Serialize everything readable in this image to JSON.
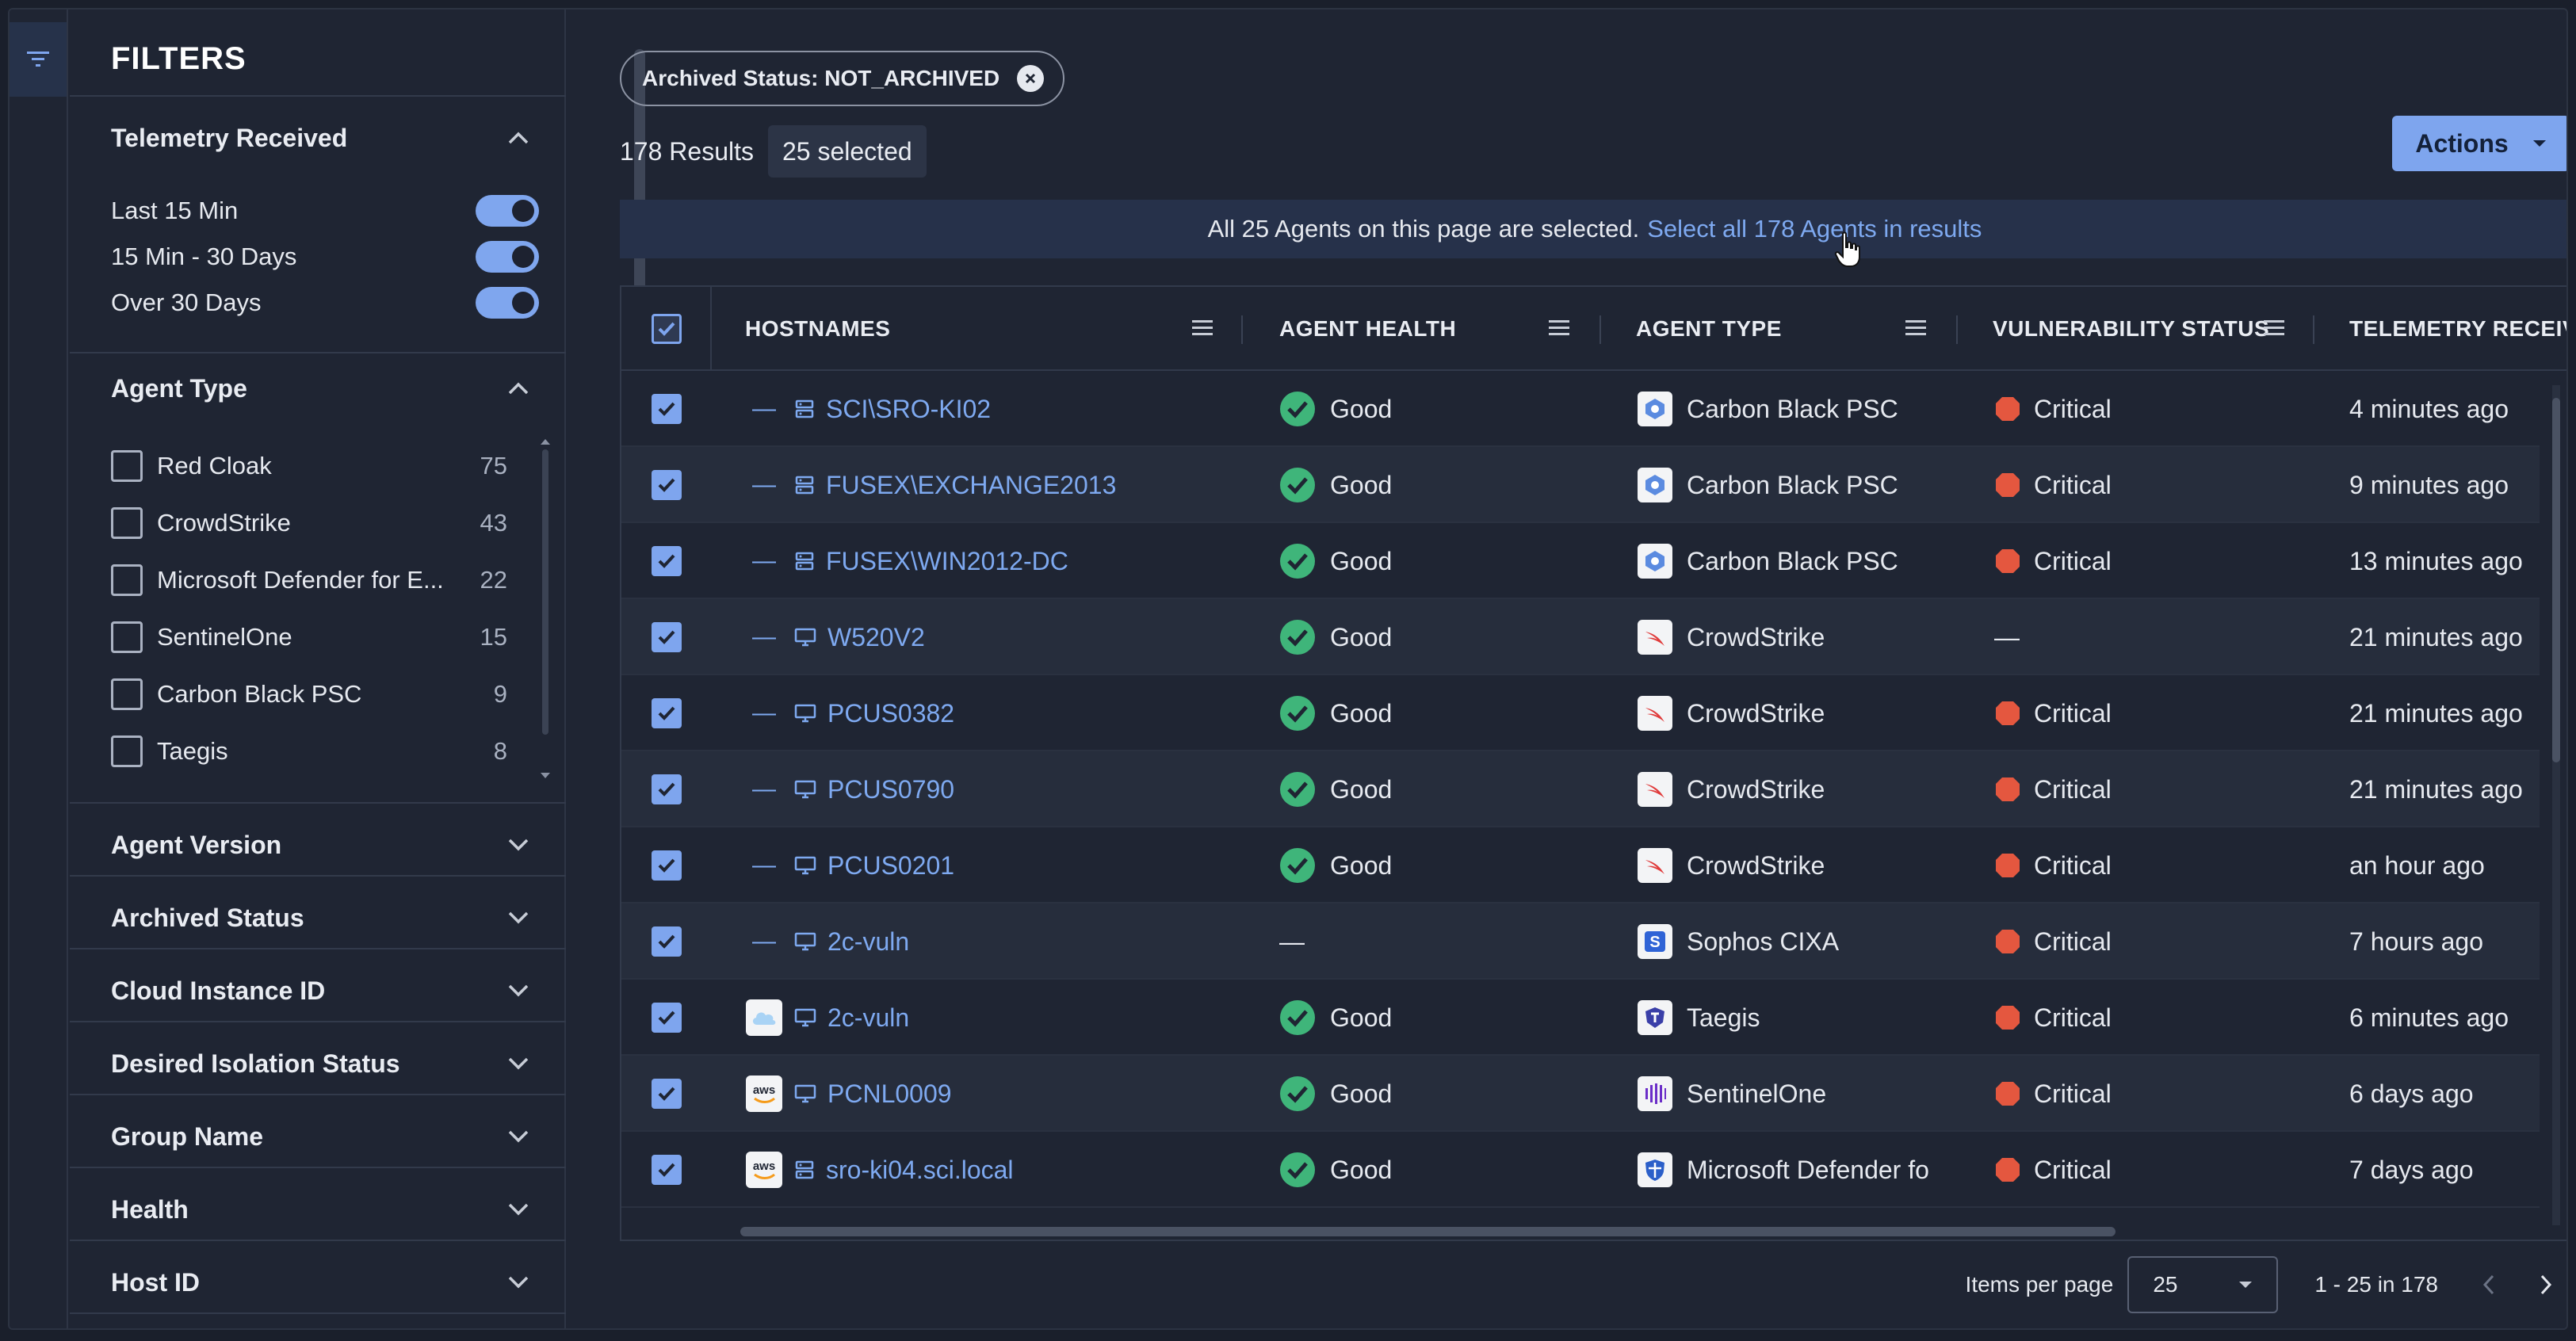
{
  "filters": {
    "title": "FILTERS",
    "sections": {
      "telemetry": {
        "label": "Telemetry Received",
        "options": [
          {
            "label": "Last 15 Min",
            "on": true
          },
          {
            "label": "15 Min - 30 Days",
            "on": true
          },
          {
            "label": "Over 30 Days",
            "on": true
          }
        ]
      },
      "agent_type": {
        "label": "Agent Type",
        "options": [
          {
            "label": "Red Cloak",
            "count": "75"
          },
          {
            "label": "CrowdStrike",
            "count": "43"
          },
          {
            "label": "Microsoft Defender for E...",
            "count": "22"
          },
          {
            "label": "SentinelOne",
            "count": "15"
          },
          {
            "label": "Carbon Black PSC",
            "count": "9"
          },
          {
            "label": "Taegis",
            "count": "8"
          }
        ]
      },
      "collapsed": [
        "Agent Version",
        "Archived Status",
        "Cloud Instance ID",
        "Desired Isolation Status",
        "Group Name",
        "Health",
        "Host ID"
      ]
    }
  },
  "chip": {
    "label": "Archived Status: NOT_ARCHIVED"
  },
  "results": {
    "count": "178 Results",
    "selected": "25 selected"
  },
  "actions": {
    "label": "Actions"
  },
  "banner": {
    "text": "All 25 Agents on this page are selected.",
    "link": "Select all 178 Agents in results"
  },
  "table": {
    "columns": [
      "HOSTNAMES",
      "AGENT HEALTH",
      "AGENT TYPE",
      "VULNERABILITY STATUS",
      "TELEMETRY RECEIV"
    ],
    "rows": [
      {
        "provider": "—",
        "host_icon": "server",
        "hostname": "SCI\\SRO-KI02",
        "health": "Good",
        "type": "Carbon Black PSC",
        "type_icon": "carbonblack",
        "vuln": "Critical",
        "telemetry": "4 minutes ago"
      },
      {
        "provider": "—",
        "host_icon": "server",
        "hostname": "FUSEX\\EXCHANGE2013",
        "health": "Good",
        "type": "Carbon Black PSC",
        "type_icon": "carbonblack",
        "vuln": "Critical",
        "telemetry": "9 minutes ago"
      },
      {
        "provider": "—",
        "host_icon": "server",
        "hostname": "FUSEX\\WIN2012-DC",
        "health": "Good",
        "type": "Carbon Black PSC",
        "type_icon": "carbonblack",
        "vuln": "Critical",
        "telemetry": "13 minutes ago"
      },
      {
        "provider": "—",
        "host_icon": "desktop",
        "hostname": "W520V2",
        "health": "Good",
        "type": "CrowdStrike",
        "type_icon": "crowdstrike",
        "vuln": "—",
        "telemetry": "21 minutes ago"
      },
      {
        "provider": "—",
        "host_icon": "desktop",
        "hostname": "PCUS0382",
        "health": "Good",
        "type": "CrowdStrike",
        "type_icon": "crowdstrike",
        "vuln": "Critical",
        "telemetry": "21 minutes ago"
      },
      {
        "provider": "—",
        "host_icon": "desktop",
        "hostname": "PCUS0790",
        "health": "Good",
        "type": "CrowdStrike",
        "type_icon": "crowdstrike",
        "vuln": "Critical",
        "telemetry": "21 minutes ago"
      },
      {
        "provider": "—",
        "host_icon": "desktop",
        "hostname": "PCUS0201",
        "health": "Good",
        "type": "CrowdStrike",
        "type_icon": "crowdstrike",
        "vuln": "Critical",
        "telemetry": "an hour ago"
      },
      {
        "provider": "—",
        "host_icon": "desktop",
        "hostname": "2c-vuln",
        "health": "—",
        "type": "Sophos CIXA",
        "type_icon": "sophos",
        "vuln": "Critical",
        "telemetry": "7 hours ago"
      },
      {
        "provider": "cloud",
        "host_icon": "desktop",
        "hostname": "2c-vuln",
        "health": "Good",
        "type": "Taegis",
        "type_icon": "taegis",
        "vuln": "Critical",
        "telemetry": "6 minutes ago"
      },
      {
        "provider": "aws",
        "host_icon": "desktop",
        "hostname": "PCNL0009",
        "health": "Good",
        "type": "SentinelOne",
        "type_icon": "sentinelone",
        "vuln": "Critical",
        "telemetry": "6 days ago"
      },
      {
        "provider": "aws",
        "host_icon": "server",
        "hostname": "sro-ki04.sci.local",
        "health": "Good",
        "type": "Microsoft Defender fo",
        "type_icon": "defender",
        "vuln": "Critical",
        "telemetry": "7 days ago"
      }
    ]
  },
  "pagination": {
    "items_per_page_label": "Items per page",
    "items_per_page": "25",
    "range": "1 - 25 in 178"
  },
  "colors": {
    "accent": "#7ea5ee",
    "critical": "#e4573f",
    "good": "#3fb57a",
    "link": "#7ea9f0"
  }
}
